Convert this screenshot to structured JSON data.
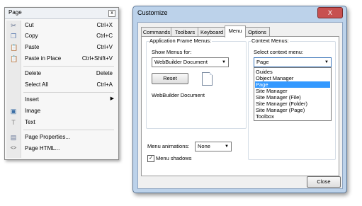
{
  "page_menu": {
    "title": "Page",
    "close_glyph": "x",
    "items": [
      {
        "icon": "scissors-icon",
        "glyph": "✂",
        "label": "Cut",
        "shortcut": "Ctrl+X",
        "color": "#5b6b8a"
      },
      {
        "icon": "copy-icon",
        "glyph": "❐",
        "label": "Copy",
        "shortcut": "Ctrl+C",
        "color": "#4a6da8"
      },
      {
        "icon": "paste-icon",
        "glyph": "📋",
        "label": "Paste",
        "shortcut": "Ctrl+V",
        "color": "#c48a2a"
      },
      {
        "icon": "paste-in-place-icon",
        "glyph": "📋",
        "label": "Paste in Place",
        "shortcut": "Ctrl+Shift+V",
        "color": "#c48a2a"
      },
      {
        "icon": "",
        "glyph": "",
        "label": "Delete",
        "shortcut": "Delete",
        "color": "#000"
      },
      {
        "icon": "",
        "glyph": "",
        "label": "Select All",
        "shortcut": "Ctrl+A",
        "color": "#000"
      },
      {
        "icon": "",
        "glyph": "",
        "label": "Insert",
        "shortcut": "",
        "color": "#000"
      },
      {
        "icon": "image-icon",
        "glyph": "▣",
        "label": "Image",
        "shortcut": "",
        "color": "#3a6ea5"
      },
      {
        "icon": "text-icon",
        "glyph": "T",
        "label": "Text",
        "shortcut": "",
        "color": "#888"
      },
      {
        "icon": "page-properties-icon",
        "glyph": "▤",
        "label": "Page Properties...",
        "shortcut": "",
        "color": "#6a7a9a"
      },
      {
        "icon": "html-icon",
        "glyph": "<>",
        "label": "Page HTML...",
        "shortcut": "",
        "color": "#444"
      }
    ],
    "submenu_arrow": "▶"
  },
  "dialog": {
    "title": "Customize",
    "close_glyph": "X",
    "tabs": [
      "Commands",
      "Toolbars",
      "Keyboard",
      "Menu",
      "Options"
    ],
    "active_tab": "Menu",
    "app_frame": {
      "group_label": "Application Frame Menus:",
      "show_label": "Show Menus for:",
      "show_value": "WebBuilder Document",
      "reset_label": "Reset",
      "doc_caption": "WebBuilder Document"
    },
    "context": {
      "group_label": "Context Menus:",
      "select_label": "Select context menu:",
      "select_value": "Page",
      "options": [
        "Guides",
        "Object Manager",
        "Page",
        "Site Manager",
        "Site Manager (File)",
        "Site Manager (Folder)",
        "Site Manager (Page)",
        "Toolbox"
      ],
      "selected_option": "Page"
    },
    "animations_label": "Menu animations:",
    "animations_value": "None",
    "shadows_label": "Menu shadows",
    "shadows_checked": true,
    "close_label": "Close"
  },
  "colors": {
    "selection": "#3399ff",
    "title_bar": "#bcd2ea",
    "close_red": "#c75050"
  }
}
